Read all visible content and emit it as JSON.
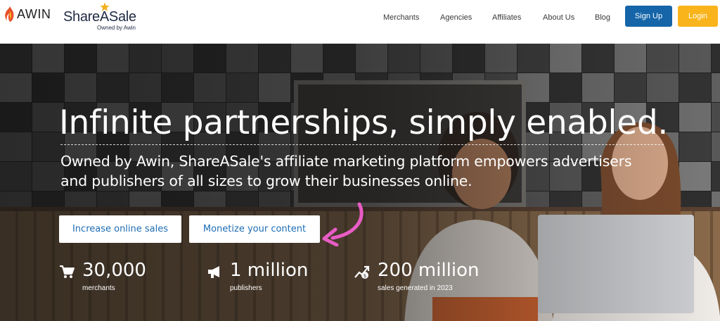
{
  "brand": {
    "awin": "AWIN",
    "shareasale": "ShareASale",
    "shareasale_sub": "Owned by Awin"
  },
  "nav": {
    "items": [
      {
        "label": "Merchants"
      },
      {
        "label": "Agencies"
      },
      {
        "label": "Affiliates"
      },
      {
        "label": "About Us"
      },
      {
        "label": "Blog"
      }
    ],
    "signup_label": "Sign Up",
    "login_label": "Login"
  },
  "hero": {
    "headline": "Infinite partnerships, simply enabled.",
    "subcopy": "Owned by Awin, ShareASale's affiliate marketing platform empowers advertisers and publishers of all sizes to grow their businesses online.",
    "cta_primary": "Increase online sales",
    "cta_secondary": "Monetize your content"
  },
  "stats": [
    {
      "icon": "cart-icon",
      "value": "30,000",
      "label": "merchants"
    },
    {
      "icon": "megaphone-icon",
      "value": "1 million",
      "label": "publishers"
    },
    {
      "icon": "growth-chart-icon",
      "value": "200 million",
      "label": "sales generated in 2023"
    }
  ],
  "colors": {
    "signup_bg": "#1565a8",
    "login_bg": "#f9b41b",
    "cta_text": "#1e6db3",
    "arrow": "#e85cc4"
  }
}
